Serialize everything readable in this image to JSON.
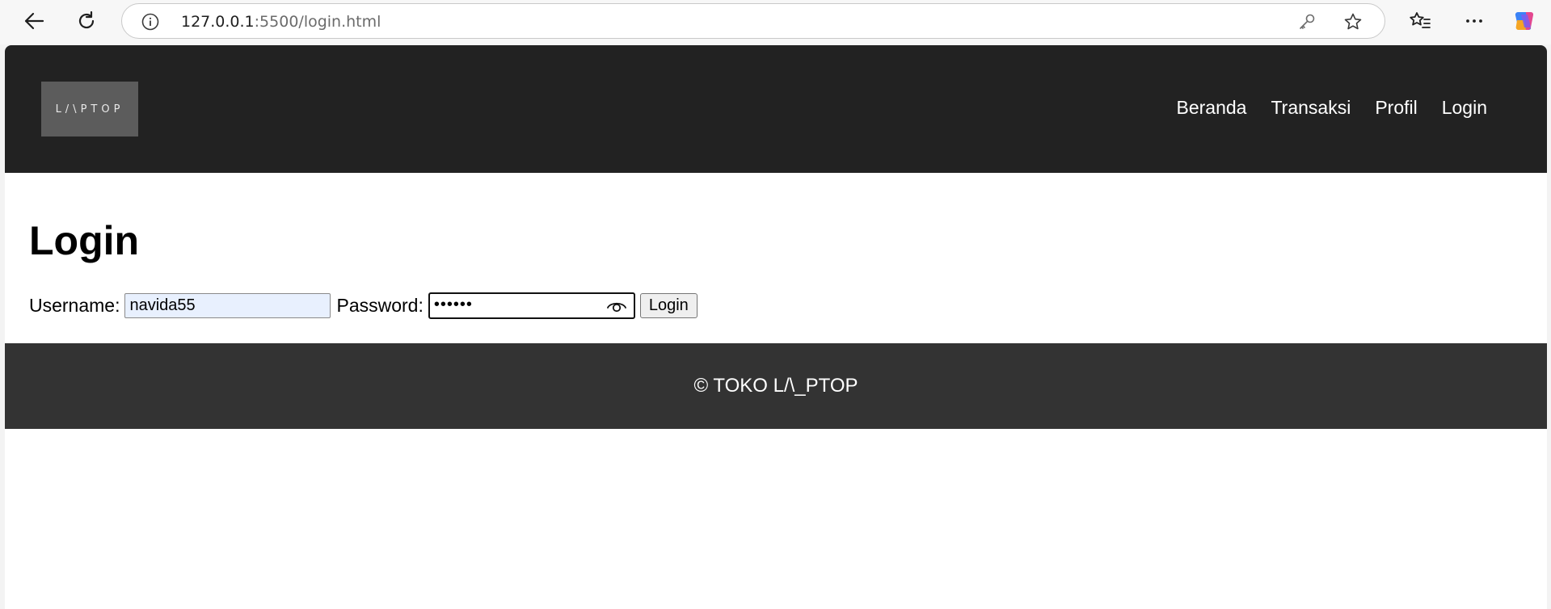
{
  "browser": {
    "url_host": "127.0.0.1",
    "url_rest": ":5500/login.html"
  },
  "header": {
    "logo_text": "L/\\PTOP",
    "nav": [
      "Beranda",
      "Transaksi",
      "Profil",
      "Login"
    ]
  },
  "main": {
    "title": "Login",
    "username_label": "Username:",
    "username_value": "navida55",
    "password_label": "Password:",
    "password_mask": "••••••",
    "login_button": "Login"
  },
  "footer": {
    "text": "© TOKO L/\\_PTOP"
  }
}
